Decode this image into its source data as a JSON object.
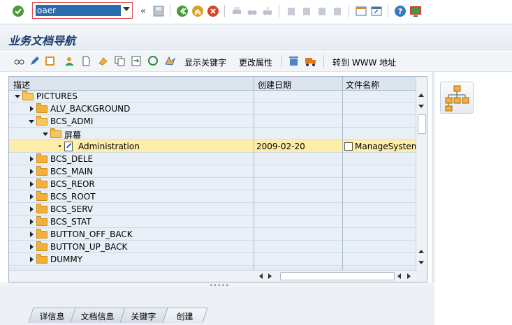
{
  "system_toolbar": {
    "command_field": {
      "value": "oaer"
    },
    "icons": [
      "enter-check-icon",
      "command-dropdown-icon",
      "collapse-icon",
      "save-icon",
      "back-icon",
      "exit-icon",
      "cancel-icon",
      "print-icon",
      "find-icon",
      "find-next-icon",
      "first-page-icon",
      "prev-page-icon",
      "next-page-icon",
      "last-page-icon",
      "create-session-icon",
      "shortcut-icon",
      "help-icon",
      "customize-layout-icon"
    ]
  },
  "title": "业务文档导航",
  "app_toolbar": {
    "show_keywords": "显示关键字",
    "change_properties": "更改属性",
    "goto_www": "转到 WWW 地址"
  },
  "tree": {
    "columns": [
      "描述",
      "创建日期",
      "文件名称"
    ],
    "rows": [
      {
        "level": 0,
        "state": "open",
        "type": "folder",
        "label": "PICTURES",
        "date": "",
        "file": ""
      },
      {
        "level": 1,
        "state": "closed",
        "type": "folder",
        "label": "ALV_BACKGROUND",
        "date": "",
        "file": ""
      },
      {
        "level": 1,
        "state": "open",
        "type": "folder",
        "label": "BCS_ADMI",
        "date": "",
        "file": ""
      },
      {
        "level": 2,
        "state": "open",
        "type": "folder",
        "label": "屏幕",
        "date": "",
        "file": ""
      },
      {
        "level": 3,
        "state": "leaf",
        "type": "document",
        "label": "Administration",
        "date": "2009-02-20",
        "file": "ManageSystem.g",
        "selected": true
      },
      {
        "level": 1,
        "state": "closed",
        "type": "folder",
        "label": "BCS_DELE",
        "date": "",
        "file": ""
      },
      {
        "level": 1,
        "state": "closed",
        "type": "folder",
        "label": "BCS_MAIN",
        "date": "",
        "file": ""
      },
      {
        "level": 1,
        "state": "closed",
        "type": "folder",
        "label": "BCS_REOR",
        "date": "",
        "file": ""
      },
      {
        "level": 1,
        "state": "closed",
        "type": "folder",
        "label": "BCS_ROOT",
        "date": "",
        "file": ""
      },
      {
        "level": 1,
        "state": "closed",
        "type": "folder",
        "label": "BCS_SERV",
        "date": "",
        "file": ""
      },
      {
        "level": 1,
        "state": "closed",
        "type": "folder",
        "label": "BCS_STAT",
        "date": "",
        "file": ""
      },
      {
        "level": 1,
        "state": "closed",
        "type": "folder",
        "label": "BUTTON_OFF_BACK",
        "date": "",
        "file": ""
      },
      {
        "level": 1,
        "state": "closed",
        "type": "folder",
        "label": "BUTTON_UP_BACK",
        "date": "",
        "file": ""
      },
      {
        "level": 1,
        "state": "closed",
        "type": "folder",
        "label": "DUMMY",
        "date": "",
        "file": ""
      }
    ]
  },
  "tabs": [
    "详信息",
    "文档信息",
    "关键字",
    "创建"
  ],
  "active_tab": 3,
  "colors": {
    "selected_row": "#fdeda7",
    "folder": "#f2b03a",
    "title_text": "#1a3d6e",
    "tree_bg": "#e8eff7",
    "command_highlight": "#2b6cb0"
  }
}
